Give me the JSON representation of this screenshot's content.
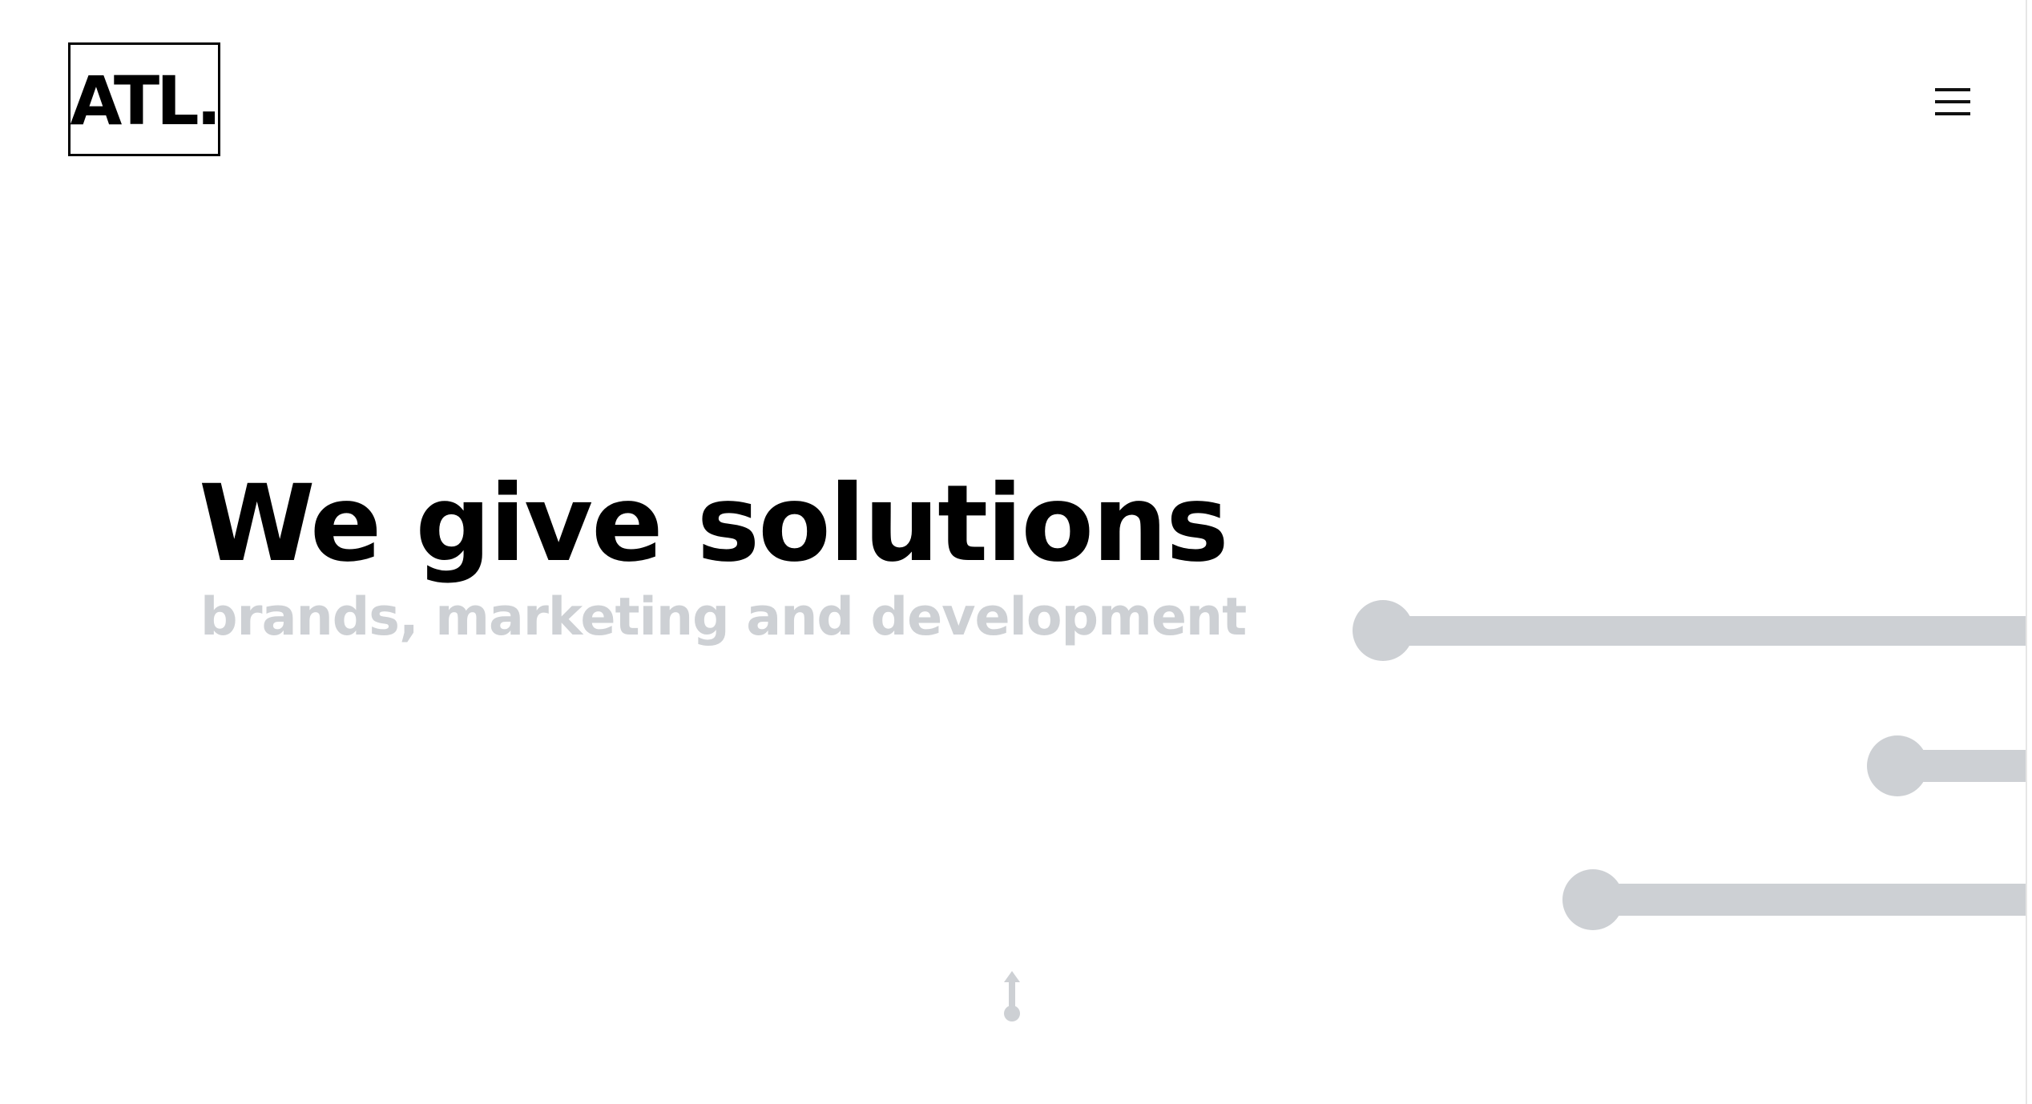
{
  "header": {
    "logo_text": "ATL.",
    "menu_icon": "hamburger-menu-icon"
  },
  "hero": {
    "headline": "We give solutions",
    "subheadline": "brands, marketing and development"
  },
  "decoration": {
    "line_color": "#cdd0d4",
    "scroll_icon": "scroll-arrow-icon"
  },
  "colors": {
    "background": "#ffffff",
    "text": "#000000",
    "muted": "#cdd0d4"
  }
}
